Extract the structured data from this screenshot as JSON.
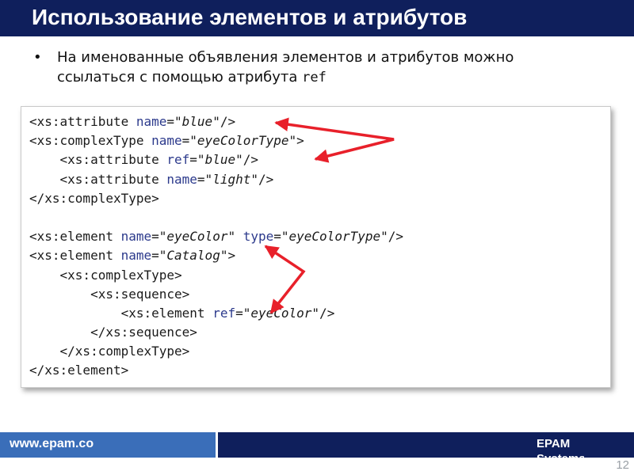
{
  "slide": {
    "title": "Использование элементов и атрибутов",
    "bullet": {
      "marker": "•",
      "text": "На именованные объявления элементов и атрибутов можно ссылаться с помощью атрибута ",
      "code": "ref"
    }
  },
  "code": {
    "lines": [
      [
        {
          "t": "tag",
          "v": "<xs:attribute "
        },
        {
          "t": "attr",
          "v": "name"
        },
        {
          "t": "tag",
          "v": "=\""
        },
        {
          "t": "val",
          "v": "blue"
        },
        {
          "t": "tag",
          "v": "\"/>"
        }
      ],
      [
        {
          "t": "tag",
          "v": "<xs:complexType "
        },
        {
          "t": "attr",
          "v": "name"
        },
        {
          "t": "tag",
          "v": "=\""
        },
        {
          "t": "val",
          "v": "eyeColorType"
        },
        {
          "t": "tag",
          "v": "\">"
        }
      ],
      [
        {
          "t": "tag",
          "v": "    <xs:attribute "
        },
        {
          "t": "attr",
          "v": "ref"
        },
        {
          "t": "tag",
          "v": "=\""
        },
        {
          "t": "val",
          "v": "blue"
        },
        {
          "t": "tag",
          "v": "\"/>"
        }
      ],
      [
        {
          "t": "tag",
          "v": "    <xs:attribute "
        },
        {
          "t": "attr",
          "v": "name"
        },
        {
          "t": "tag",
          "v": "=\""
        },
        {
          "t": "val",
          "v": "light"
        },
        {
          "t": "tag",
          "v": "\"/>"
        }
      ],
      [
        {
          "t": "tag",
          "v": "</xs:complexType>"
        }
      ],
      [
        {
          "t": "tag",
          "v": " "
        }
      ],
      [
        {
          "t": "tag",
          "v": "<xs:element "
        },
        {
          "t": "attr",
          "v": "name"
        },
        {
          "t": "tag",
          "v": "=\""
        },
        {
          "t": "val",
          "v": "eyeColor"
        },
        {
          "t": "tag",
          "v": "\" "
        },
        {
          "t": "attr",
          "v": "type"
        },
        {
          "t": "tag",
          "v": "=\""
        },
        {
          "t": "val",
          "v": "eyeColorType"
        },
        {
          "t": "tag",
          "v": "\"/>"
        }
      ],
      [
        {
          "t": "tag",
          "v": "<xs:element "
        },
        {
          "t": "attr",
          "v": "name"
        },
        {
          "t": "tag",
          "v": "=\""
        },
        {
          "t": "val",
          "v": "Catalog"
        },
        {
          "t": "tag",
          "v": "\">"
        }
      ],
      [
        {
          "t": "tag",
          "v": "    <xs:complexType>"
        }
      ],
      [
        {
          "t": "tag",
          "v": "        <xs:sequence>"
        }
      ],
      [
        {
          "t": "tag",
          "v": "            <xs:element "
        },
        {
          "t": "attr",
          "v": "ref"
        },
        {
          "t": "tag",
          "v": "=\""
        },
        {
          "t": "val",
          "v": "eyeColor"
        },
        {
          "t": "tag",
          "v": "\"/>"
        }
      ],
      [
        {
          "t": "tag",
          "v": "        </xs:sequence>"
        }
      ],
      [
        {
          "t": "tag",
          "v": "    </xs:complexType>"
        }
      ],
      [
        {
          "t": "tag",
          "v": "</xs:element>"
        }
      ]
    ]
  },
  "footer": {
    "url": "www.epam.co",
    "brand": "EPAM Systems"
  },
  "page_number": "12",
  "colors": {
    "title_bar": "#0f1f5c",
    "footer_left": "#3a6eb9",
    "footer_right": "#0f1f5c",
    "arrow": "#e8202a"
  }
}
